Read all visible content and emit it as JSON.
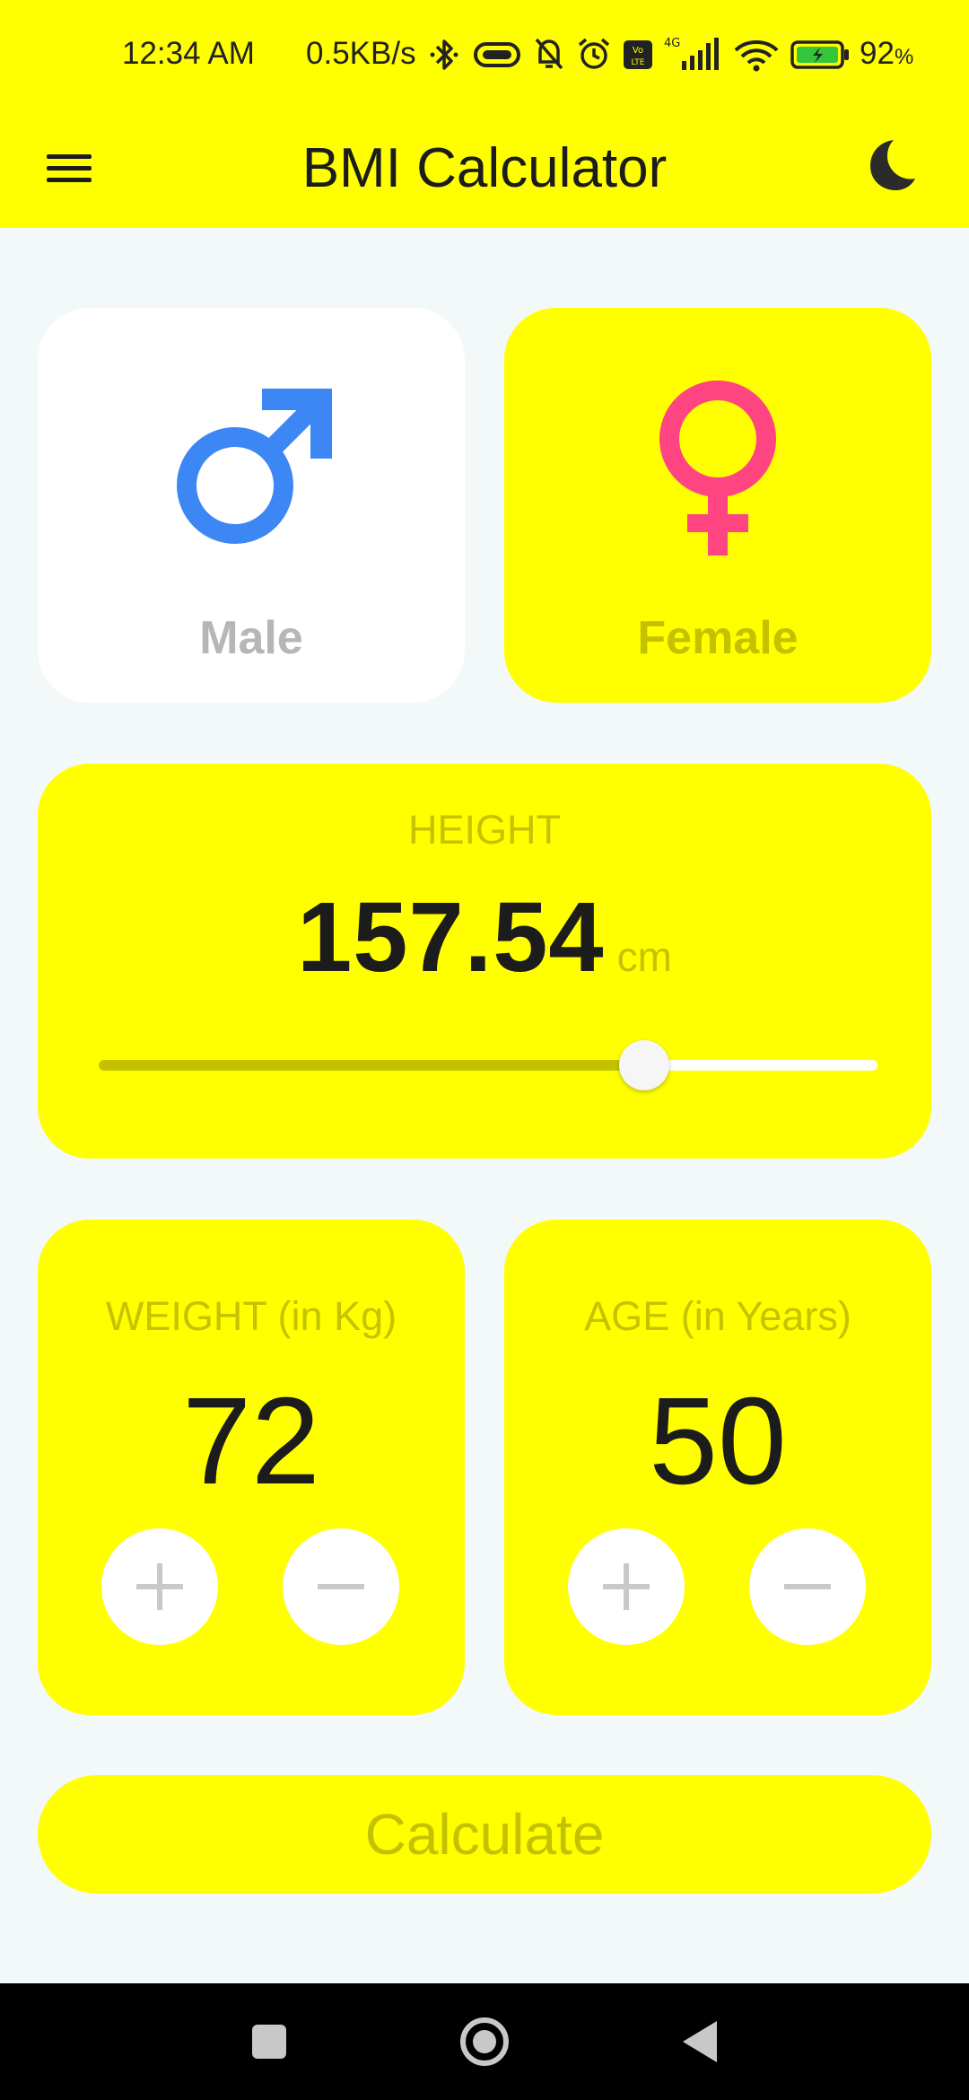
{
  "status_bar": {
    "time": "12:34 AM",
    "net_speed": "0.5KB/s",
    "battery_percent": "92",
    "battery_unit": "%",
    "icons": [
      "bluetooth-icon",
      "vibrate-icon",
      "mute-icon",
      "alarm-icon",
      "volte-icon",
      "signal-4g-icon",
      "wifi-icon",
      "battery-icon"
    ]
  },
  "app_bar": {
    "title": "BMI Calculator",
    "menu_icon": "hamburger-menu-icon",
    "theme_icon": "moon-icon"
  },
  "gender": {
    "male_label": "Male",
    "female_label": "Female",
    "selected": "male",
    "male_color": "#3d87f5",
    "female_color": "#ff4482"
  },
  "height": {
    "label": "HEIGHT",
    "value": "157.54",
    "unit": "cm",
    "slider_fraction": 0.7
  },
  "weight": {
    "label": "WEIGHT (in Kg)",
    "value": "72"
  },
  "age": {
    "label": "AGE (in Years)",
    "value": "50"
  },
  "calculate_label": "Calculate",
  "colors": {
    "accent": "#ffff00",
    "accent_dark": "#c4c200",
    "background": "#f3f8f8"
  }
}
